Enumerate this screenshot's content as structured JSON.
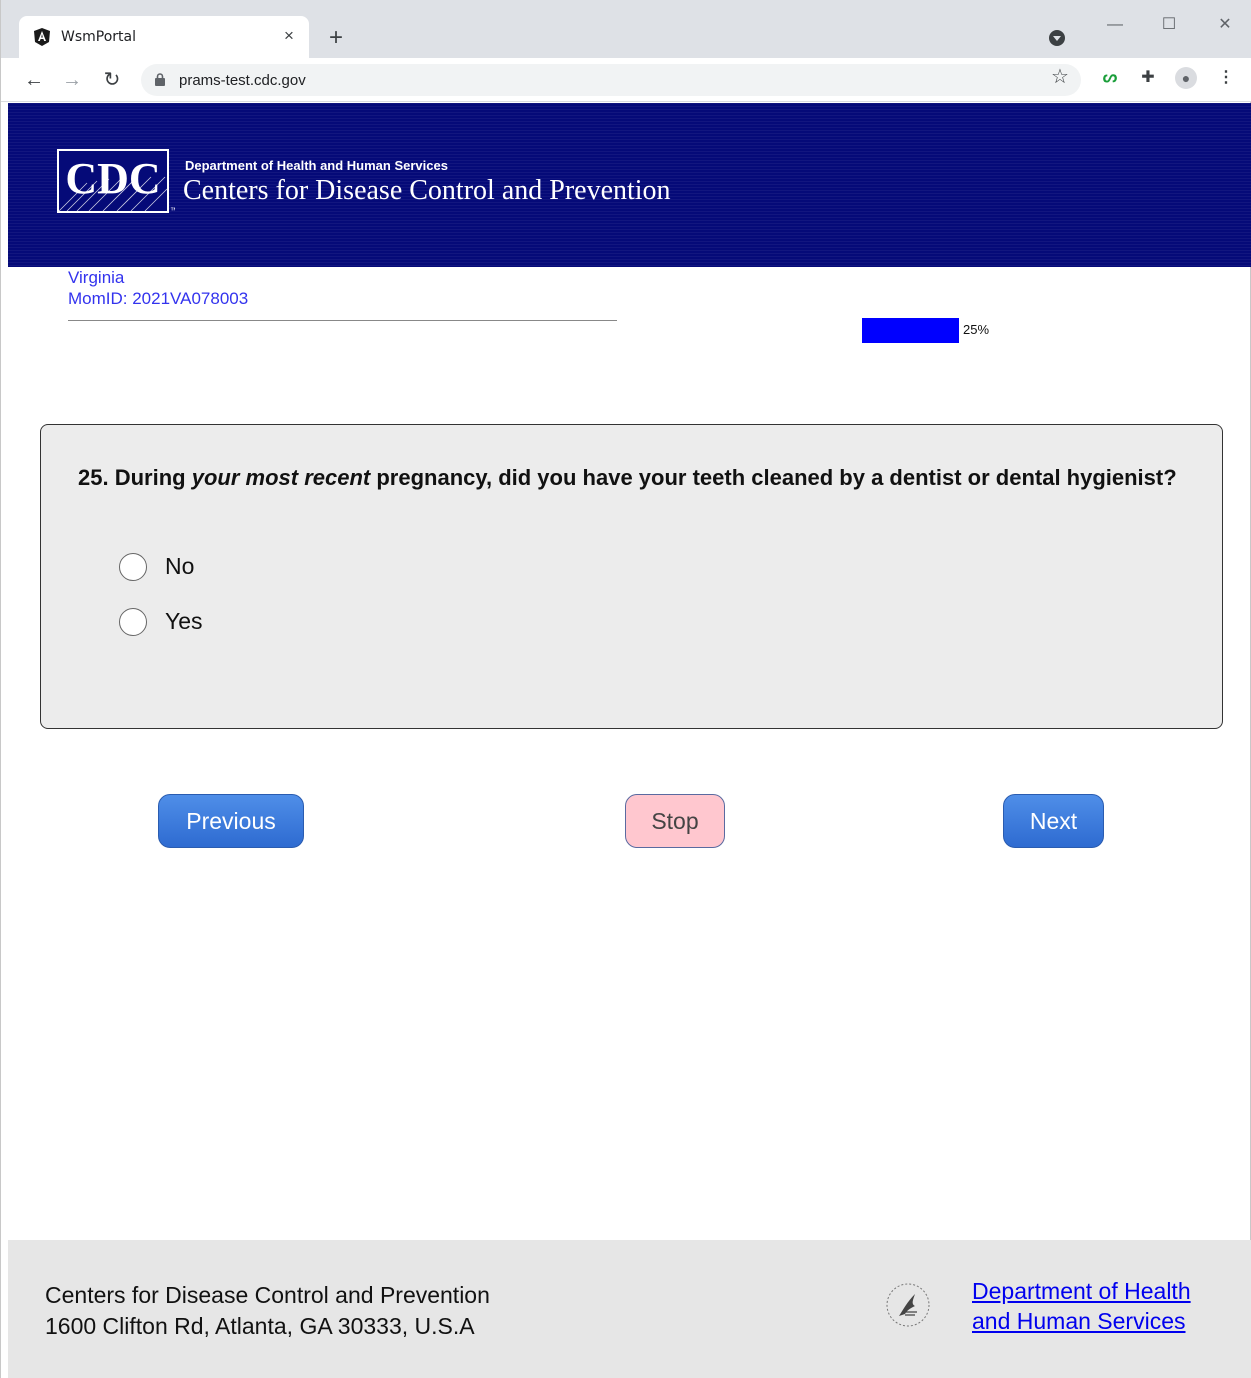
{
  "browser": {
    "tab_title": "WsmPortal",
    "tab_close": "×",
    "new_tab": "+",
    "url": "prams-test.cdc.gov",
    "window_controls": {
      "minimize": "—",
      "maximize": "☐",
      "close": "✕"
    }
  },
  "header": {
    "logo_text": "CDC",
    "department": "Department of Health and Human Services",
    "agency": "Centers for Disease Control and Prevention",
    "background": "#050a78"
  },
  "respondent": {
    "state": "Virginia",
    "mom_id": "MomID: 2021VA078003"
  },
  "progress": {
    "percent": 25,
    "label": "25%",
    "color": "#0000ff"
  },
  "question": {
    "number": "25.",
    "text_before": "During",
    "text_emphasis": "your most recent",
    "text_after": "pregnancy, did you have your teeth cleaned by a dentist or dental hygienist?",
    "options": [
      {
        "label": "No",
        "selected": false
      },
      {
        "label": "Yes",
        "selected": false
      }
    ]
  },
  "buttons": {
    "previous": "Previous",
    "stop": "Stop",
    "next": "Next"
  },
  "footer": {
    "org_name": "Centers for Disease Control and Prevention",
    "address": "1600 Clifton Rd, Atlanta, GA 30333, U.S.A",
    "hhs_link": "Department of Health and Human Services"
  }
}
